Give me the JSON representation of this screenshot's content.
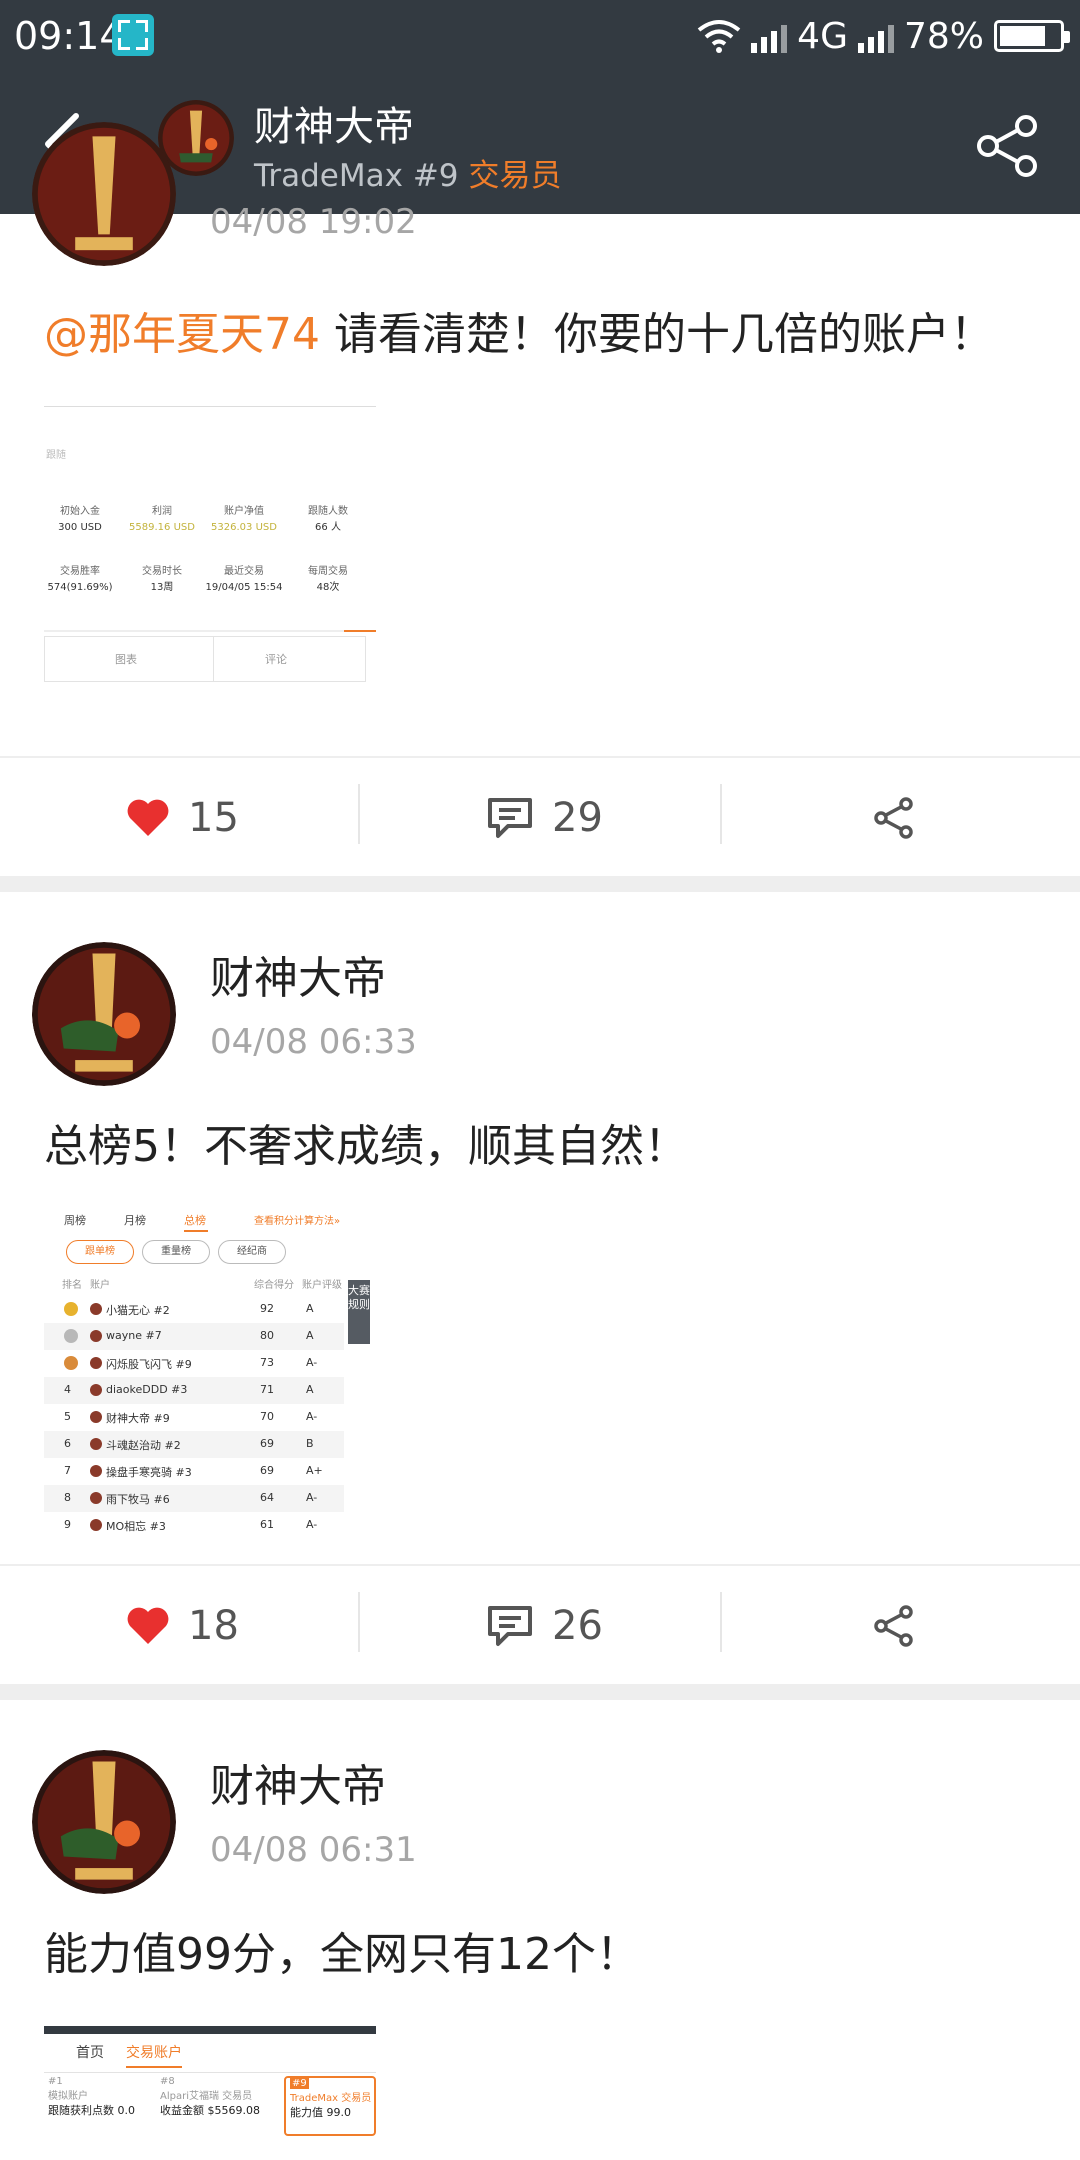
{
  "status_bar": {
    "time": "09:14",
    "network": "4G",
    "battery": "78%",
    "battery_level": 0.78
  },
  "header": {
    "title": "财神大帝",
    "subtitle": "TradeMax #9",
    "role": "交易员"
  },
  "icons": {
    "back": "chevron-left-icon",
    "share": "share-icon",
    "like": "heart-icon",
    "comment": "comment-icon"
  },
  "colors": {
    "header_bg": "#333a41",
    "accent": "#f07d2a",
    "like_red": "#e8302f"
  },
  "posts": [
    {
      "author": "财神大帝",
      "time": "04/08 19:02",
      "mention": "@那年夏天74",
      "text": " 请看清楚！你要的十几倍的账户！",
      "likes": "15",
      "comments": "29",
      "image": {
        "stats": [
          {
            "label": "初始入金",
            "value": "300 USD"
          },
          {
            "label": "利润",
            "value": "5589.16 USD"
          },
          {
            "label": "账户净值",
            "value": "5326.03 USD"
          },
          {
            "label": "跟随人数",
            "value": "66 人"
          },
          {
            "label": "交易胜率",
            "value": "574(91.69%)"
          },
          {
            "label": "交易时长",
            "value": "13周"
          },
          {
            "label": "最近交易",
            "value": "19/04/05 15:54"
          },
          {
            "label": "每周交易",
            "value": "48次"
          }
        ],
        "tab_chart": "图表",
        "tab_comment": "评论",
        "side_label": "跟随"
      }
    },
    {
      "author": "财神大帝",
      "time": "04/08 06:33",
      "text": "总榜5！不奢求成绩，顺其自然！",
      "likes": "18",
      "comments": "26",
      "image": {
        "tabs": [
          "周榜",
          "月榜",
          "总榜"
        ],
        "link": "查看积分计算方法»",
        "filters": [
          "跟单榜",
          "重量榜",
          "经纪商"
        ],
        "col_rank": "排名",
        "col_account": "账户",
        "col_score": "综合得分",
        "col_grade": "账户评级",
        "side_tab": "大赛规则",
        "rows": [
          {
            "rank": "",
            "name": "小猫无心 #2",
            "score": "92",
            "grade": "A"
          },
          {
            "rank": "",
            "name": "wayne #7",
            "score": "80",
            "grade": "A"
          },
          {
            "rank": "",
            "name": "闪烁股飞闪飞 #9",
            "score": "73",
            "grade": "A-"
          },
          {
            "rank": "4",
            "name": "diaokeDDD #3",
            "score": "71",
            "grade": "A"
          },
          {
            "rank": "5",
            "name": "财神大帝 #9",
            "score": "70",
            "grade": "A-"
          },
          {
            "rank": "6",
            "name": "斗魂赵治动 #2",
            "score": "69",
            "grade": "B"
          },
          {
            "rank": "7",
            "name": "操盘手寒亮骑 #3",
            "score": "69",
            "grade": "A+"
          },
          {
            "rank": "8",
            "name": "雨下牧马 #6",
            "score": "64",
            "grade": "A-"
          },
          {
            "rank": "9",
            "name": "MO相忘 #3",
            "score": "61",
            "grade": "A-"
          }
        ]
      }
    },
    {
      "author": "财神大帝",
      "time": "04/08 06:31",
      "text": "能力值99分，全网只有12个！",
      "image": {
        "tab_home": "首页",
        "tab_account": "交易账户",
        "cards": [
          {
            "num": "#1",
            "label": "模拟账户",
            "value": "跟随获利点数 0.0"
          },
          {
            "num": "#8",
            "label": "Alpari艾福瑞 交易员",
            "value": "收益金额 $5569.08"
          },
          {
            "num": "#9",
            "label": "TradeMax 交易员",
            "value": "能力值 99.0"
          }
        ]
      }
    }
  ]
}
